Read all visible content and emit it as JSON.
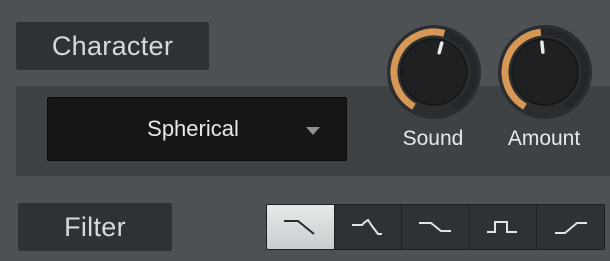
{
  "character": {
    "label": "Character"
  },
  "dropdown": {
    "value": "Spherical",
    "icon": "chevron-down-icon"
  },
  "knobs": {
    "sound": {
      "label": "Sound",
      "value": 0.55
    },
    "amount": {
      "label": "Amount",
      "value": 0.48
    }
  },
  "filter": {
    "label": "Filter",
    "types": [
      {
        "icon": "lowpass-filter-icon",
        "active": true
      },
      {
        "icon": "peak-filter-icon",
        "active": false
      },
      {
        "icon": "lowshelf-filter-icon",
        "active": false
      },
      {
        "icon": "bandpass-filter-icon",
        "active": false
      },
      {
        "icon": "highshelf-filter-icon",
        "active": false
      }
    ]
  },
  "colors": {
    "background": "#4d5154",
    "panel": "#3e4244",
    "accent": "#d89855",
    "label_bg": "#2f3234"
  }
}
